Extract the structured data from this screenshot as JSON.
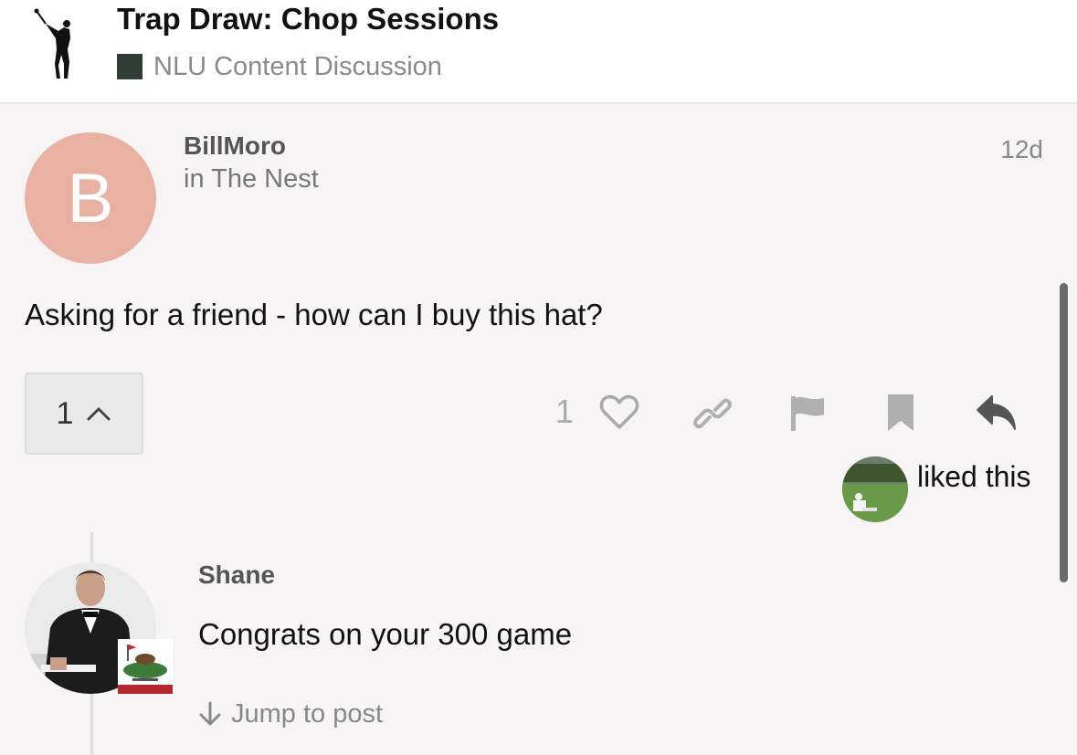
{
  "header": {
    "title": "Trap Draw: Chop Sessions",
    "category": "NLU Content Discussion",
    "category_color": "#2f3e34",
    "logo": "golfer-silhouette"
  },
  "post": {
    "avatar_letter": "B",
    "avatar_color": "#e8b1a2",
    "username": "BillMoro",
    "in_category": "in The Nest",
    "age": "12d",
    "body": "Asking for a friend - how can I buy this hat?",
    "vote_count": "1",
    "like_count": "1",
    "actions": [
      "heart-icon",
      "link-icon",
      "flag-icon",
      "bookmark-icon",
      "reply-icon"
    ],
    "liked_by_text": "liked this"
  },
  "reply": {
    "username": "Shane",
    "body": "Congrats on your 300 game",
    "jump_label": "Jump to post"
  }
}
